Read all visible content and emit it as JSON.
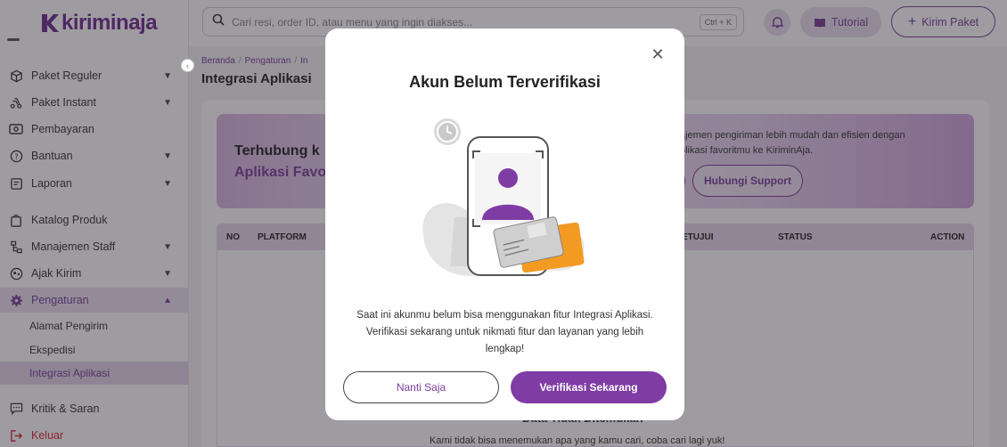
{
  "app": {
    "logo_text": "kiriminaja"
  },
  "sidebar": {
    "items": [
      {
        "label": "Paket Reguler",
        "icon": "package-icon"
      },
      {
        "label": "Paket Instant",
        "icon": "instant-delivery-icon"
      },
      {
        "label": "Pembayaran",
        "icon": "payment-icon"
      },
      {
        "label": "Bantuan",
        "icon": "help-icon"
      },
      {
        "label": "Laporan",
        "icon": "report-icon"
      },
      {
        "label": "Katalog Produk",
        "icon": "catalog-icon"
      },
      {
        "label": "Manajemen Staff",
        "icon": "staff-icon"
      },
      {
        "label": "Ajak Kirim",
        "icon": "referral-icon"
      },
      {
        "label": "Pengaturan",
        "icon": "settings-icon"
      }
    ],
    "sub_items": [
      {
        "label": "Alamat Pengirim"
      },
      {
        "label": "Ekspedisi"
      },
      {
        "label": "Integrasi Aplikasi"
      }
    ],
    "feedback": {
      "label": "Kritik & Saran",
      "icon": "feedback-icon"
    },
    "logout": {
      "label": "Keluar",
      "icon": "logout-icon"
    }
  },
  "topbar": {
    "search_placeholder": "Cari resi, order ID, atau menu yang ingin diakses...",
    "shortcut": "Ctrl + K",
    "tutorial_label": "Tutorial",
    "kirim_label": "Kirim Paket"
  },
  "main": {
    "breadcrumb": [
      "Beranda",
      "Pengaturan",
      "In"
    ],
    "title": "Integrasi Aplikasi",
    "banner": {
      "title_line1": "Terhubung k",
      "title_line2": "Aplikasi Favo",
      "desc_line1": "ajemen pengiriman lebih mudah dan efisien dengan",
      "desc_line2": "plikasi favoritmu ke KiriminAja.",
      "support_label": "Hubungi Support"
    },
    "table_headers": {
      "no": "NO",
      "platform": "PLATFORM",
      "approval": "ETUJUI",
      "status": "STATUS",
      "action": "ACTION"
    },
    "empty_title": "Data Tidak Ditemukan",
    "empty_desc": "Kami tidak bisa menemukan apa yang kamu cari, coba cari lagi yuk!"
  },
  "modal": {
    "title": "Akun Belum Terverifikasi",
    "body_line1": "Saat ini akunmu belum bisa menggunakan fitur Integrasi Aplikasi.",
    "body_line2": "Verifikasi sekarang untuk nikmati fitur dan layanan yang lebih",
    "body_line3": "lengkap!",
    "later_label": "Nanti Saja",
    "verify_label": "Verifikasi Sekarang"
  },
  "colors": {
    "brand": "#7a3c9a",
    "button_primary": "#7f3ca4",
    "logout": "#d8283b",
    "card_orange": "#f29a21"
  }
}
